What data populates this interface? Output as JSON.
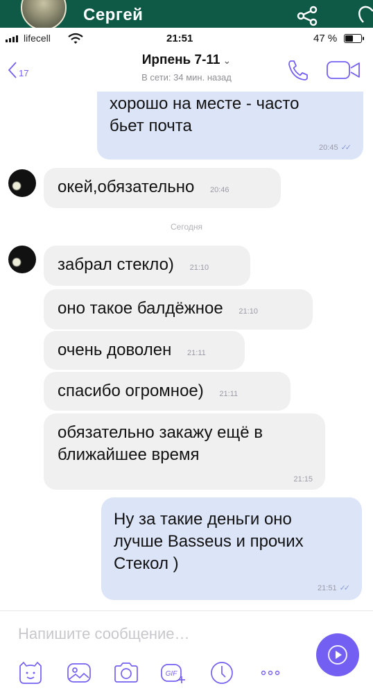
{
  "share_bar": {
    "contact_name": "Сергей",
    "icons": [
      "avatar-photo",
      "share-icon",
      "more-icon"
    ],
    "color": "#0f5a47"
  },
  "status_bar": {
    "carrier": "lifecell",
    "time": "21:51",
    "battery_text": "47 %",
    "battery_level": 0.47
  },
  "header": {
    "back_count": "17",
    "title": "Ирпень 7-11",
    "title_chevron": "⌄",
    "subtitle": "В сети: 34 мин. назад",
    "icons": [
      "back-icon",
      "call-icon",
      "video-call-icon"
    ]
  },
  "messages": [
    {
      "direction": "out",
      "lines": [
        "хорошо на месте - часто",
        "бьет почта"
      ],
      "time": "20:45",
      "ticks": "✓✓"
    },
    {
      "direction": "in",
      "lines": [
        "окей,обязательно"
      ],
      "time": "20:46"
    },
    {
      "day_divider": "Сегодня"
    },
    {
      "direction": "in",
      "lines": [
        "забрал стекло)"
      ],
      "time": "21:10"
    },
    {
      "direction": "in",
      "lines": [
        "оно такое балдёжное"
      ],
      "time": "21:10"
    },
    {
      "direction": "in",
      "lines": [
        "очень доволен"
      ],
      "time": "21:11"
    },
    {
      "direction": "in",
      "lines": [
        "спасибо огромное)"
      ],
      "time": "21:11"
    },
    {
      "direction": "in",
      "lines": [
        "обязательно закажу ещё в",
        "ближайшее время"
      ],
      "time": "21:15"
    },
    {
      "direction": "out",
      "lines": [
        "Ну за такие деньги оно",
        "лучше Basseus и прочих",
        "Стекол )"
      ],
      "time": "21:51",
      "ticks": "✓✓"
    }
  ],
  "composer": {
    "placeholder": "Напишите сообщение…",
    "tools": [
      "sticker-icon",
      "gallery-icon",
      "camera-icon",
      "gif-icon",
      "timer-icon",
      "more-options-icon"
    ],
    "accent": "#7360f2"
  },
  "colors": {
    "outgoing_bubble": "#dce4f8",
    "incoming_bubble": "#f0f0f1"
  }
}
